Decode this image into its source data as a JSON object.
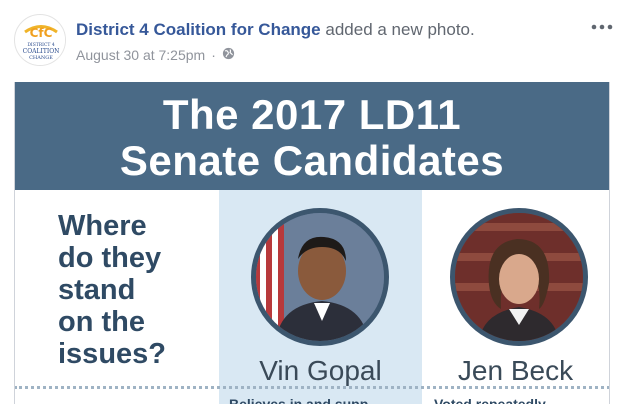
{
  "post": {
    "author": "District 4 Coalition for Change",
    "action": "added a new photo.",
    "timestamp": "August 30 at 7:25pm",
    "separator": "·",
    "avatar": {
      "logo_letters": "CfC",
      "line1": "DISTRICT 4",
      "line2": "COALITION",
      "line3": "CHANGE"
    }
  },
  "photo": {
    "title_line1": "The 2017 LD11",
    "title_line2": "Senate Candidates",
    "question_lines": [
      "Where",
      "do they",
      "stand",
      "on the",
      "issues?"
    ],
    "candidates": [
      {
        "name": "Vin Gopal",
        "cut_text": "Believes in and supp"
      },
      {
        "name": "Jen Beck",
        "cut_text": "Voted repeatedly"
      }
    ]
  },
  "colors": {
    "author_blue": "#365899",
    "banner": "#4a6a86",
    "question_text": "#2f4a64",
    "candidate_highlight": "#d9e8f3"
  },
  "icons": [
    "more-options-icon",
    "globe-icon"
  ]
}
